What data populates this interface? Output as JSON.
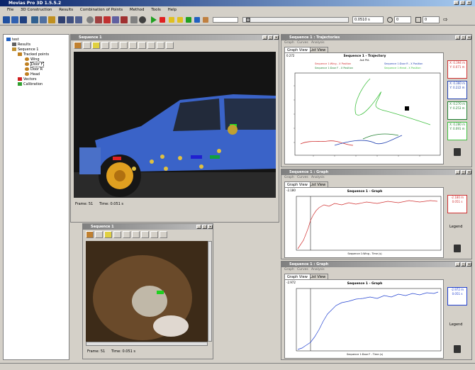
{
  "app": {
    "title": "Movias Pro 3D 1.5.5.2"
  },
  "menu": [
    "File",
    "3D Construction",
    "Results",
    "Combination of Points",
    "Method",
    "Tools",
    "Help"
  ],
  "toolbar": {
    "time1": "0.0510 s",
    "field1": "0",
    "field2": "0"
  },
  "tree": {
    "root": "test",
    "results": "Results",
    "sequence": "Sequence 1",
    "tracked": "Tracked points",
    "points": [
      "Wing",
      "Door F",
      "Door R",
      "Head"
    ],
    "vectors": "Vectors",
    "calibration": "Calibration"
  },
  "seq_main": {
    "title": "Sequence 1",
    "frame": "Frame: 51",
    "time": "Time: 0.051 s"
  },
  "seq_small": {
    "title": "Sequence 1",
    "frame": "Frame: 51",
    "time": "Time: 0.051 s"
  },
  "traj": {
    "title": "Sequence 1 : Trajectories",
    "menu": "Graph   Curves   Analysis",
    "tab1": "Graph View",
    "tab2": "List View",
    "corner": "0.272",
    "chart_title": "Sequence 1 - Trajectory",
    "chart_sub": "Ask Pkt.",
    "legend": [
      "Sequence 1:Wing - X Position",
      "Sequence 1:Door R - X Position",
      "Sequence 1:Door F - X Position",
      "Sequence 1:Head - X Position"
    ],
    "boxes": [
      {
        "v1": "X: 0.394 m",
        "v2": "Y: 0.071 m",
        "color": "#d03030"
      },
      {
        "v1": "X: 0.360 m",
        "v2": "Y: 0.222 m",
        "color": "#2040b0"
      },
      {
        "v1": "X: 0.270 m",
        "v2": "Y: 0.253 m",
        "color": "#208030"
      },
      {
        "v1": "X: 0.280 m",
        "v2": "Y: 0.091 m",
        "color": "#40c040"
      }
    ]
  },
  "graph1": {
    "title": "Sequence 1 : Graph",
    "menu": "Graph   Curves   Analysis",
    "tab1": "Graph View",
    "tab2": "List View",
    "corner": "-2.180",
    "chart_title": "Sequence 1 - Graph",
    "xlabel": "Sequence 1:Wing - Time (s)",
    "box_v1": "-2.180 m",
    "box_v2": "0.051 s",
    "legend_btn": "Legend",
    "color": "#d03030"
  },
  "graph2": {
    "title": "Sequence 1 : Graph",
    "menu": "Graph   Curves   Analysis",
    "tab1": "Graph View",
    "tab2": "List View",
    "corner": "-2.972",
    "chart_title": "Sequence 1 - Graph",
    "xlabel": "Sequence 1:Door F - Time (s)",
    "box_v1": "-2.972 m",
    "box_v2": "0.051 s",
    "legend_btn": "Legend",
    "color": "#2040d0"
  },
  "chart_data": [
    {
      "type": "line",
      "title": "Sequence 1 - Trajectory",
      "series": [
        {
          "name": "Sequence 1:Wing - X Position",
          "color": "#d03030"
        },
        {
          "name": "Sequence 1:Door R - X Position",
          "color": "#2040b0"
        },
        {
          "name": "Sequence 1:Door F - X Position",
          "color": "#208030"
        },
        {
          "name": "Sequence 1:Head - X Position",
          "color": "#40c040"
        }
      ]
    },
    {
      "type": "line",
      "title": "Sequence 1 - Graph",
      "xlabel": "Sequence 1:Wing - Time (s)",
      "series": [
        {
          "color": "#d03030"
        }
      ]
    },
    {
      "type": "line",
      "title": "Sequence 1 - Graph",
      "xlabel": "Sequence 1:Door F - Time (s)",
      "series": [
        {
          "color": "#2040d0"
        }
      ]
    }
  ]
}
